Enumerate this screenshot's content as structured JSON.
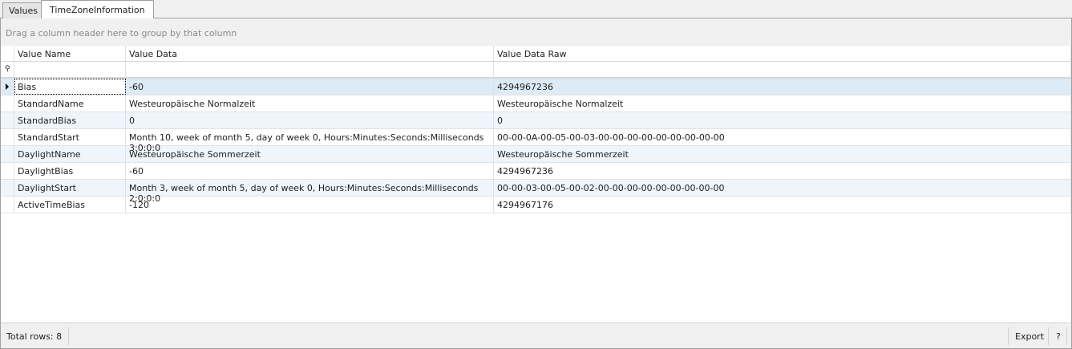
{
  "tabs": [
    {
      "label": "Values"
    },
    {
      "label": "TimeZoneInformation"
    }
  ],
  "group_hint": "Drag a column header here to group by that column",
  "columns": [
    "Value Name",
    "Value Data",
    "Value Data Raw"
  ],
  "rows": [
    [
      "Bias",
      "-60",
      "4294967236"
    ],
    [
      "StandardName",
      "Westeuropäische Normalzeit",
      "Westeuropäische Normalzeit"
    ],
    [
      "StandardBias",
      "0",
      "0"
    ],
    [
      "StandardStart",
      "Month 10, week of month 5, day of week 0, Hours:Minutes:Seconds:Milliseconds 3:0:0:0",
      "00-00-0A-00-05-00-03-00-00-00-00-00-00-00-00-00"
    ],
    [
      "DaylightName",
      "Westeuropäische Sommerzeit",
      "Westeuropäische Sommerzeit"
    ],
    [
      "DaylightBias",
      "-60",
      "4294967236"
    ],
    [
      "DaylightStart",
      "Month 3, week of month 5, day of week 0, Hours:Minutes:Seconds:Milliseconds 2:0:0:0",
      "00-00-03-00-05-00-02-00-00-00-00-00-00-00-00-00"
    ],
    [
      "ActiveTimeBias",
      "-120",
      "4294967176"
    ]
  ],
  "footer": {
    "total": "Total rows: 8",
    "export": "Export",
    "help": "?"
  }
}
